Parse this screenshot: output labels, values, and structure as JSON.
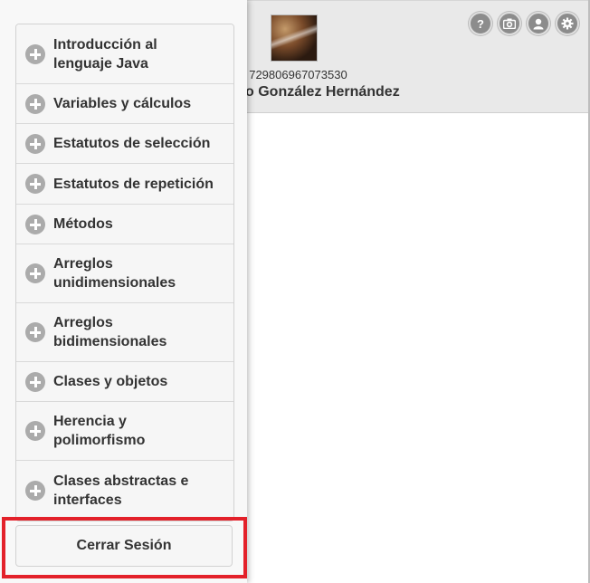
{
  "user": {
    "id_text": ": 729806967073530",
    "name_text": "o González Hernández"
  },
  "header_icons": [
    "help-icon",
    "camera-icon",
    "user-icon",
    "settings-icon"
  ],
  "menu": {
    "items": [
      {
        "label": "Introducción al lenguaje Java"
      },
      {
        "label": "Variables y cálculos"
      },
      {
        "label": "Estatutos de selección"
      },
      {
        "label": "Estatutos de repetición"
      },
      {
        "label": "Métodos"
      },
      {
        "label": "Arreglos unidimensionales"
      },
      {
        "label": "Arreglos bidimensionales"
      },
      {
        "label": "Clases y objetos"
      },
      {
        "label": "Herencia y polimorfismo"
      },
      {
        "label": "Clases abstractas e interfaces"
      }
    ]
  },
  "logout": {
    "label": "Cerrar Sesión"
  },
  "colors": {
    "highlight": "#e3212a",
    "header_bg": "#e9e9e9",
    "icon_bg": "#8c8c8c"
  }
}
